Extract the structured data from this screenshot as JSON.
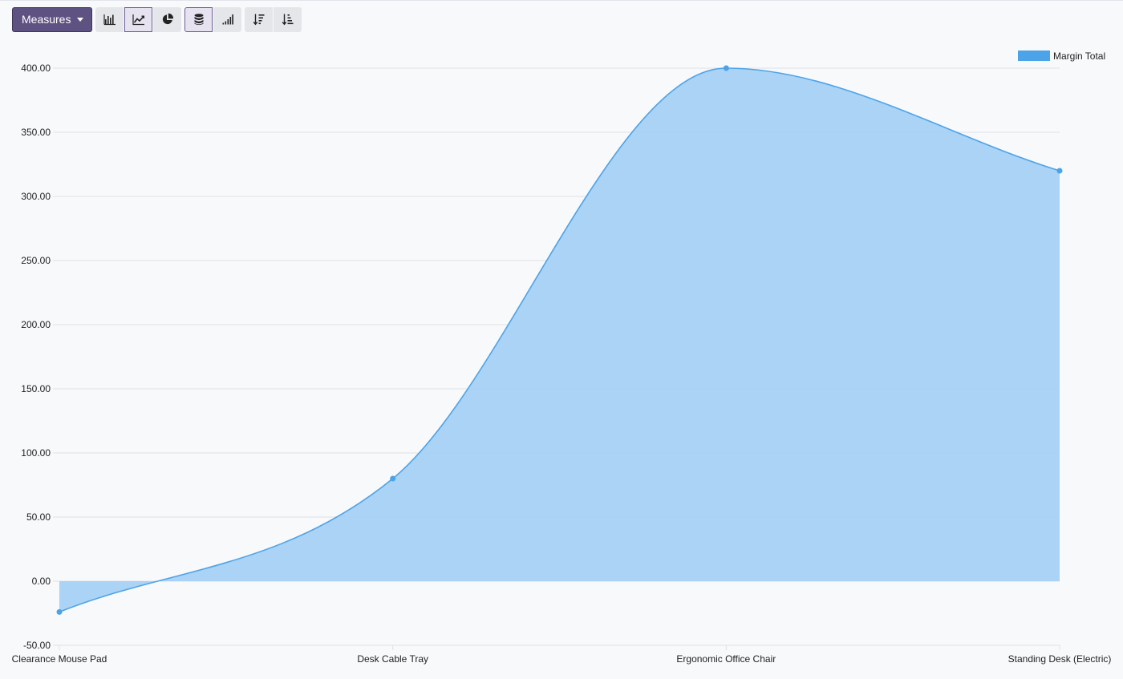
{
  "toolbar": {
    "measures_label": "Measures",
    "buttons": [
      {
        "name": "bar-chart-icon",
        "active": false
      },
      {
        "name": "line-chart-icon",
        "active": true
      },
      {
        "name": "pie-chart-icon",
        "active": false
      },
      {
        "name": "stacked-icon",
        "active": true
      },
      {
        "name": "cumulative-icon",
        "active": false
      },
      {
        "name": "sort-descending-icon",
        "active": false
      },
      {
        "name": "sort-ascending-icon",
        "active": false
      }
    ]
  },
  "colors": {
    "accent": "#5e5282",
    "line": "#4da3e8",
    "fill": "#a5d1f6",
    "grid": "#dfe1e5"
  },
  "chart_data": {
    "type": "area",
    "categories": [
      "Clearance Mouse Pad",
      "Desk Cable Tray",
      "Ergonomic Office Chair",
      "Standing Desk (Electric)"
    ],
    "series": [
      {
        "name": "Margin Total",
        "values": [
          -24,
          80,
          400,
          320
        ]
      }
    ],
    "ylim": [
      -50,
      400
    ],
    "yticks": [
      "-50.00",
      "0.00",
      "50.00",
      "100.00",
      "150.00",
      "200.00",
      "250.00",
      "300.00",
      "350.00",
      "400.00"
    ],
    "grid": true,
    "legend": "top-right",
    "smooth": true
  }
}
